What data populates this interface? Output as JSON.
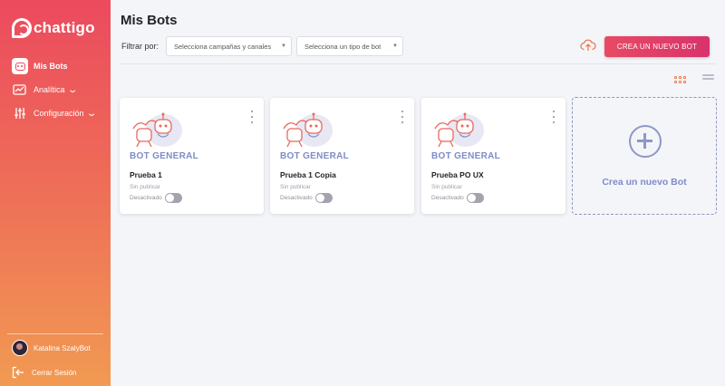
{
  "app": {
    "logo_text": "chattigo"
  },
  "sidebar": {
    "items": [
      {
        "label": "Mis Bots",
        "icon": "bot-icon",
        "active": true
      },
      {
        "label": "Analítica",
        "icon": "analytics-icon",
        "has_submenu": true
      },
      {
        "label": "Configuración",
        "icon": "sliders-icon",
        "has_submenu": true
      }
    ],
    "user": {
      "name": "Katalina SzalyBot"
    },
    "logout_label": "Cerrar Sesión"
  },
  "header": {
    "title": "Mis Bots",
    "filter_label": "Filtrar por:",
    "filters": [
      {
        "value": "Selecciona campañas y canales"
      },
      {
        "value": "Selecciona un tipo de bot"
      }
    ],
    "upload_icon": "cloud-upload-icon",
    "new_bot_button": "CREA UN NUEVO BOT"
  },
  "view": {
    "active": "grid",
    "options": [
      "grid-view-icon",
      "list-view-icon"
    ]
  },
  "bots": [
    {
      "type": "BOT GENERAL",
      "name": "Prueba 1",
      "status": "Sin publicar",
      "toggle_label": "Desactivado",
      "enabled": false
    },
    {
      "type": "BOT GENERAL",
      "name": "Prueba 1 Copia",
      "status": "Sin publicar",
      "toggle_label": "Desactivado",
      "enabled": false
    },
    {
      "type": "BOT GENERAL",
      "name": "Prueba PO UX",
      "status": "Sin publicar",
      "toggle_label": "Desactivado",
      "enabled": false
    }
  ],
  "new_bot_card": {
    "label": "Crea un nuevo Bot"
  },
  "colors": {
    "accent": "#e84a64",
    "brand_purple": "#7f8cc6",
    "sidebar_top": "#ec4a5e",
    "sidebar_bottom": "#f19a52"
  }
}
